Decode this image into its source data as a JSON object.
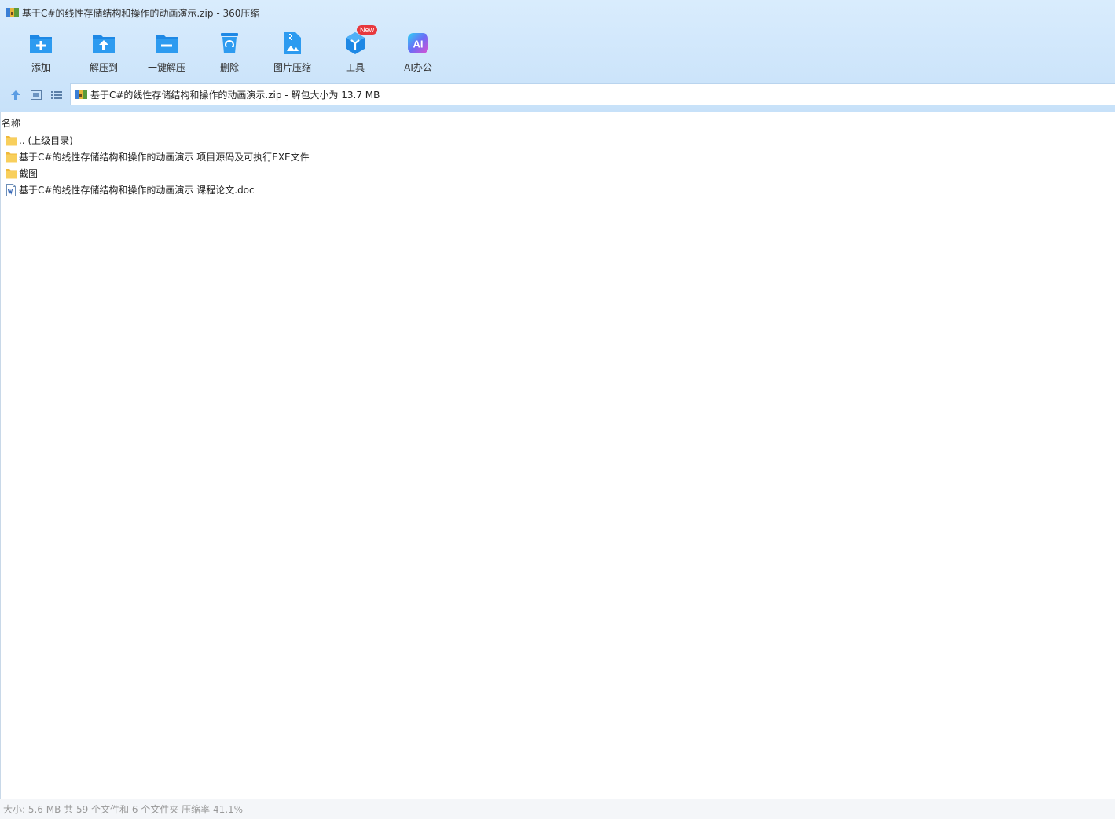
{
  "window": {
    "title": "基于C#的线性存储结构和操作的动画演示.zip - 360压缩",
    "app_icon": "archive-icon"
  },
  "toolbar": {
    "items": [
      {
        "label": "添加",
        "icon": "add-folder-icon"
      },
      {
        "label": "解压到",
        "icon": "extract-to-icon"
      },
      {
        "label": "一键解压",
        "icon": "one-click-extract-icon"
      },
      {
        "label": "删除",
        "icon": "recycle-bin-icon"
      },
      {
        "label": "图片压缩",
        "icon": "image-compress-icon"
      },
      {
        "label": "工具",
        "icon": "tools-cube-icon",
        "badge": "New"
      },
      {
        "label": "AI办公",
        "icon": "ai-office-icon",
        "icon_text": "AI"
      }
    ]
  },
  "nav": {
    "address": "基于C#的线性存储结构和操作的动画演示.zip - 解包大小为 13.7 MB"
  },
  "file_list": {
    "column_name": "名称",
    "rows": [
      {
        "name": ".. (上级目录)",
        "type": "folder"
      },
      {
        "name": "基于C#的线性存储结构和操作的动画演示 项目源码及可执行EXE文件",
        "type": "folder"
      },
      {
        "name": "截图",
        "type": "folder"
      },
      {
        "name": "基于C#的线性存储结构和操作的动画演示 课程论文.doc",
        "type": "doc"
      }
    ]
  },
  "status": {
    "text": "大小: 5.6 MB 共 59 个文件和 6 个文件夹 压缩率 41.1%"
  },
  "colors": {
    "accent": "#1e88e5",
    "header_bg": "#d3e8fc",
    "folder": "#f8cf5c",
    "badge": "#e8383d"
  }
}
